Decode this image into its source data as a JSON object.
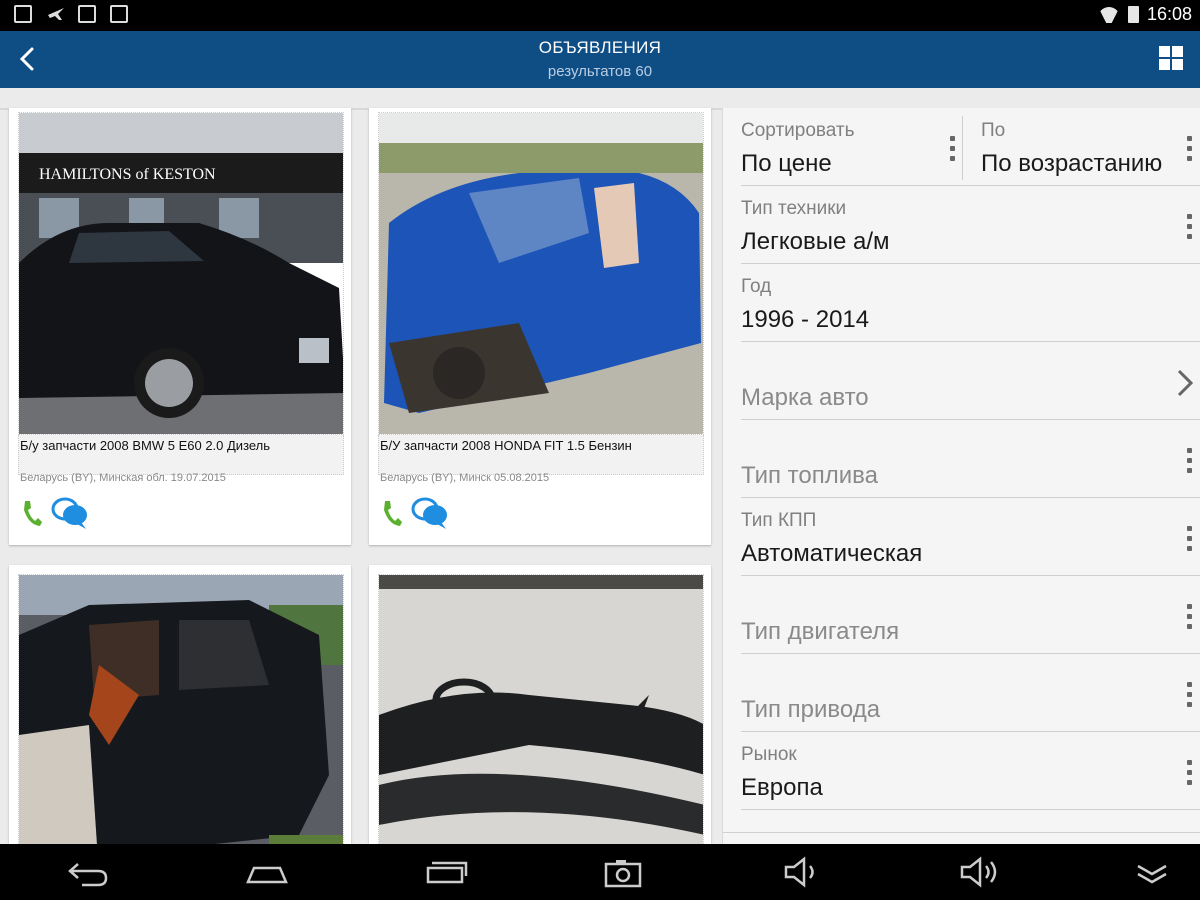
{
  "status_bar": {
    "time": "16:08"
  },
  "header": {
    "title": "ОБЪЯВЛЕНИЯ",
    "subtitle": "результатов 60"
  },
  "listings": [
    {
      "title": "Б/у запчасти 2008 BMW 5 E60 2.0 Дизель",
      "meta": "Беларусь (BY), Минская обл. 19.07.2015",
      "shop_sign": "HAMILTONS of KESTON"
    },
    {
      "title": "Б/У запчасти 2008 HONDA FIT 1.5 Бензин",
      "meta": "Беларусь (BY), Минск 05.08.2015"
    },
    {
      "title": "",
      "meta": ""
    },
    {
      "title": "",
      "meta": ""
    }
  ],
  "filters": {
    "sort_label": "Сортировать",
    "sort_value": "По цене",
    "order_label": "По",
    "order_value": "По возрастанию",
    "vehicle_type_label": "Тип техники",
    "vehicle_type_value": "Легковые а/м",
    "year_label": "Год",
    "year_value": "1996 - 2014",
    "brand_placeholder": "Марка авто",
    "fuel_placeholder": "Тип топлива",
    "gearbox_label": "Тип КПП",
    "gearbox_value": "Автоматическая",
    "engine_placeholder": "Тип двигателя",
    "drive_placeholder": "Тип привода",
    "market_label": "Рынок",
    "market_value": "Европа"
  },
  "colors": {
    "action_bar": "#0f4d85",
    "phone_icon": "#5bb030",
    "chat_icon": "#1f8de0"
  }
}
